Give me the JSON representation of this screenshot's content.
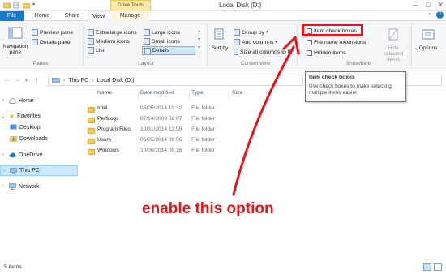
{
  "window": {
    "title": "Local Disk (D:)",
    "context_tab": "Drive Tools"
  },
  "tabs": {
    "file": "File",
    "home": "Home",
    "share": "Share",
    "view": "View",
    "manage": "Manage"
  },
  "ribbon": {
    "panes": {
      "navigation_pane": "Navigation pane",
      "preview_pane": "Preview pane",
      "details_pane": "Details pane",
      "label": "Panes"
    },
    "layout": {
      "extra_large_icons": "Extra large icons",
      "large_icons": "Large icons",
      "medium_icons": "Medium icons",
      "small_icons": "Small icons",
      "list": "List",
      "details": "Details",
      "label": "Layout"
    },
    "current_view": {
      "sort_by": "Sort by",
      "group_by": "Group by",
      "add_columns": "Add columns",
      "size_all_columns": "Size all columns to fit",
      "label": "Current view"
    },
    "show_hide": {
      "item_check_boxes": "Item check boxes",
      "file_name_extensions": "File name extensions",
      "hidden_items": "Hidden items",
      "hide_selected_items": "Hide selected items",
      "label": "Show/hide"
    },
    "options": "Options"
  },
  "tooltip": {
    "title": "Item check boxes",
    "body": "Use check boxes to make selecting multiple items easier."
  },
  "address": {
    "this_pc": "This PC",
    "location": "Local Disk (D:)"
  },
  "nav": {
    "home": "Home",
    "favorites": "Favorites",
    "desktop": "Desktop",
    "downloads": "Downloads",
    "onedrive": "OneDrive",
    "this_pc": "This PC",
    "network": "Network"
  },
  "columns": {
    "name": "Name",
    "date_modified": "Date modified",
    "type": "Type",
    "size": "Size"
  },
  "files": [
    {
      "name": "Intel",
      "date": "06/05/2014 10:32",
      "type": "File folder"
    },
    {
      "name": "PerfLogs",
      "date": "07/14/2009 08:07",
      "type": "File folder"
    },
    {
      "name": "Program Files",
      "date": "10/31/2014 12:59",
      "type": "File folder"
    },
    {
      "name": "Users",
      "date": "06/05/2014 09:56",
      "type": "File folder"
    },
    {
      "name": "Windows",
      "date": "10/06/2014 09:16",
      "type": "File folder"
    }
  ],
  "status": {
    "count": "5 items"
  },
  "annotation": {
    "text": "enable this option"
  },
  "colors": {
    "accent": "#1979ca",
    "highlight": "#e8141b",
    "drive_tools": "#fbe9a8"
  }
}
